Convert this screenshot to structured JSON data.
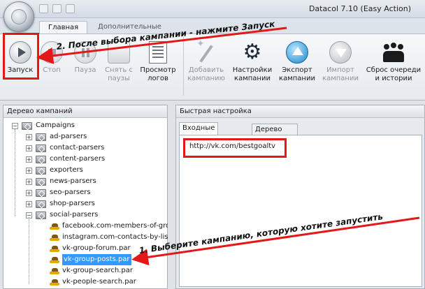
{
  "window": {
    "title": "Datacol 7.10 (Easy Action)"
  },
  "ribbon_tabs": [
    {
      "label": "Главная",
      "active": true
    },
    {
      "label": "Дополнительные",
      "active": false
    }
  ],
  "ribbon": {
    "start": "Запуск",
    "stop": "Стоп",
    "pause": "Пауза",
    "unpause": "Снять с\nпаузы",
    "view_logs": "Просмотр\nлогов",
    "add_campaign": "Добавить\nкампанию",
    "campaign_settings": "Настройки\nкампании",
    "export_campaign": "Экспорт\nкампании",
    "import_campaign": "Импорт\nкампании",
    "reset_queue": "Сброс очереди\nи истории"
  },
  "left_panel": {
    "title": "Дерево кампаний",
    "root": "Campaigns",
    "folders": [
      "ad-parsers",
      "contact-parsers",
      "content-parsers",
      "exporters",
      "news-parsers",
      "seo-parsers",
      "shop-parsers",
      "social-parsers"
    ],
    "social_files": [
      "facebook.com-members-of-gro",
      "instagram.com-contacts-by-lis",
      "vk-group-forum.par",
      "vk-group-posts.par",
      "vk-group-search.par",
      "vk-people-search.par"
    ],
    "selected_file": "vk-group-posts.par"
  },
  "right_panel": {
    "title": "Быстрая настройка",
    "tabs": [
      {
        "label": "Входные данные",
        "active": true
      },
      {
        "label": "Дерево быстрой настройки",
        "active": false
      }
    ],
    "input_value": "http://vk.com/bestgoaltv"
  },
  "annotations": {
    "step1": "1. Выберите кампанию, которую хотите запустить",
    "step2": "2. После выбора кампании - нажмите Запуск",
    "color": "#e31818"
  }
}
